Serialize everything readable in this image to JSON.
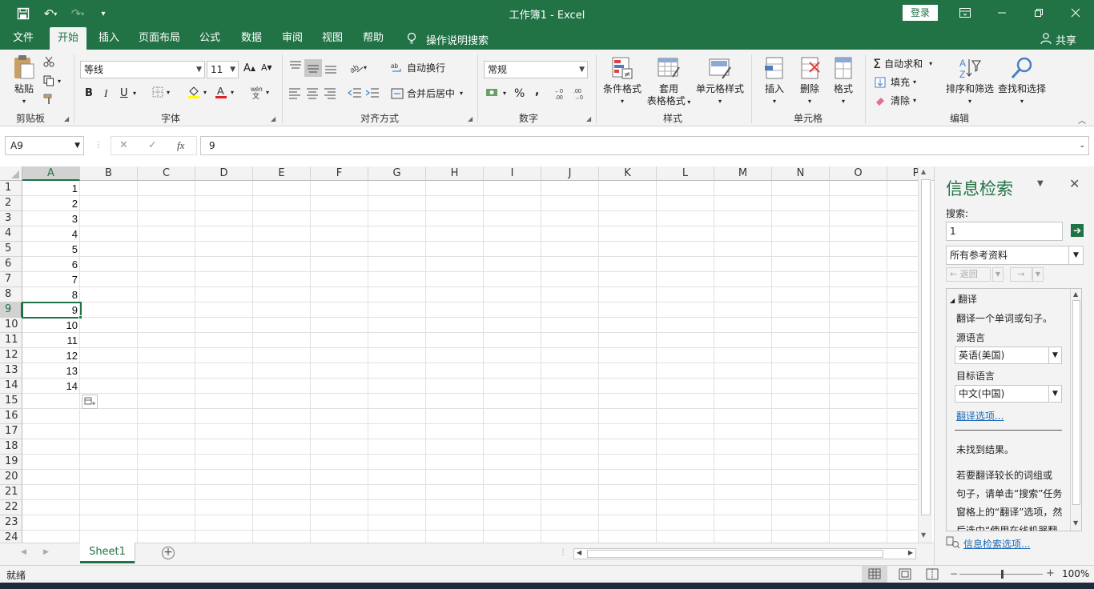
{
  "window": {
    "title": "工作簿1  -  Excel",
    "login_label": "登录"
  },
  "menu": {
    "tabs": [
      "文件",
      "开始",
      "插入",
      "页面布局",
      "公式",
      "数据",
      "审阅",
      "视图",
      "帮助"
    ],
    "tell_me": "操作说明搜索",
    "share": "共享"
  },
  "ribbon": {
    "clipboard": {
      "paste": "粘贴",
      "label": "剪贴板"
    },
    "font": {
      "name": "等线",
      "size": "11",
      "bold": "B",
      "italic": "I",
      "underline": "U",
      "grow": "A",
      "shrink": "A",
      "label": "字体"
    },
    "alignment": {
      "wrap": "自动换行",
      "merge": "合并后居中",
      "label": "对齐方式"
    },
    "number": {
      "format": "常规",
      "percent": "%",
      "comma": ",",
      "label": "数字"
    },
    "styles": {
      "conditional": "条件格式",
      "table1": "套用",
      "table2": "表格格式",
      "cell_styles": "单元格样式",
      "label": "样式"
    },
    "cells": {
      "insert": "插入",
      "delete": "删除",
      "format": "格式",
      "label": "单元格"
    },
    "editing": {
      "autosum": "自动求和",
      "fill": "填充",
      "clear": "清除",
      "sort": "排序和筛选",
      "find": "查找和选择",
      "label": "编辑"
    }
  },
  "formula_bar": {
    "name_box": "A9",
    "fx": "fx",
    "value": "9"
  },
  "sheet": {
    "columns": [
      "A",
      "B",
      "C",
      "D",
      "E",
      "F",
      "G",
      "H",
      "I",
      "J",
      "K",
      "L",
      "M",
      "N",
      "O",
      "P"
    ],
    "rows": [
      "1",
      "2",
      "3",
      "4",
      "5",
      "6",
      "7",
      "8",
      "9",
      "10",
      "11",
      "12",
      "13",
      "14",
      "15",
      "16",
      "17",
      "18",
      "19",
      "20",
      "21",
      "22",
      "23",
      "24"
    ],
    "column_a_values": [
      "1",
      "2",
      "3",
      "4",
      "5",
      "6",
      "7",
      "8",
      "9",
      "10",
      "11",
      "12",
      "13",
      "14"
    ],
    "selected_cell": "A9",
    "tab_name": "Sheet1"
  },
  "research_pane": {
    "title": "信息检索",
    "search_label": "搜索:",
    "search_value": "1",
    "source": "所有参考资料",
    "back": "返回",
    "section": "翻译",
    "desc": "翻译一个单词或句子。",
    "source_lang_label": "源语言",
    "source_lang": "英语(美国)",
    "target_lang_label": "目标语言",
    "target_lang": "中文(中国)",
    "options_link": "翻译选项...",
    "no_result": "未找到结果。",
    "help_lines": [
      "若要翻译较长的词组或",
      "句子，请单击“搜索”任务",
      "窗格上的“翻译”选项，然",
      "后选中“使用在线机器翻"
    ],
    "footer_link": "信息检索选项..."
  },
  "status": {
    "ready": "就绪",
    "zoom": "100%"
  }
}
